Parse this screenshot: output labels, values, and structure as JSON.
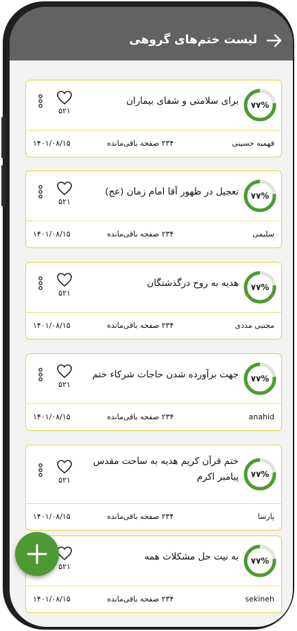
{
  "header": {
    "title": "لیست ختم‌های گروهی",
    "back_icon": "arrow-right-icon"
  },
  "colors": {
    "header_bg": "#626262",
    "card_border": "#e9cf3e",
    "progress": "#4e9a32",
    "fab": "#4e9a32"
  },
  "cards": [
    {
      "title": "برای سلامتی و شفای بیماران",
      "progress_label": "۷۷%",
      "progress": 0.77,
      "likes": "۵۲۱",
      "owner": "فهمیه حسینی",
      "remaining": "۲۳۴ صفحه باقی‌مانده",
      "date": "۱۴۰۱/۰۸/۱۵"
    },
    {
      "title": "تعجیل در ظهور آقا امام زمان (عج)",
      "progress_label": "۷۷%",
      "progress": 0.77,
      "likes": "۵۲۱",
      "owner": "سلیمی",
      "remaining": "۲۳۴ صفحه باقی‌مانده",
      "date": "۱۴۰۱/۰۸/۱۵"
    },
    {
      "title": "هدیه به روح درگذشتگان",
      "progress_label": "۷۷%",
      "progress": 0.77,
      "likes": "۵۲۱",
      "owner": "مجتبی مددی",
      "remaining": "۲۳۴ صفحه باقی‌مانده",
      "date": "۱۴۰۱/۰۸/۱۵"
    },
    {
      "title": "جهت برآورده شدن حاجات شرکاء ختم",
      "progress_label": "۷۷%",
      "progress": 0.77,
      "likes": "۵۲۱",
      "owner": "anahid",
      "remaining": "۲۳۴ صفحه باقی‌مانده",
      "date": "۱۴۰۱/۰۸/۱۵"
    },
    {
      "title": "ختم قرآن کریم هدیه به ساحت مقدس پیامبر اکرم",
      "progress_label": "۷۷%",
      "progress": 0.77,
      "likes": "۵۲۱",
      "owner": "پارسا",
      "remaining": "۲۳۴ صفحه باقی‌مانده",
      "date": "۱۴۰۱/۰۸/۱۵"
    },
    {
      "title": "به نیت حل مشکلات همه",
      "progress_label": "۷۷%",
      "progress": 0.77,
      "likes": "۵۲۱",
      "owner": "sekineh",
      "remaining": "۲۳۴ صفحه باقی‌مانده",
      "date": "۱۴۰۱/۰۸/۱۵"
    }
  ],
  "fab": {
    "icon": "plus-icon"
  }
}
